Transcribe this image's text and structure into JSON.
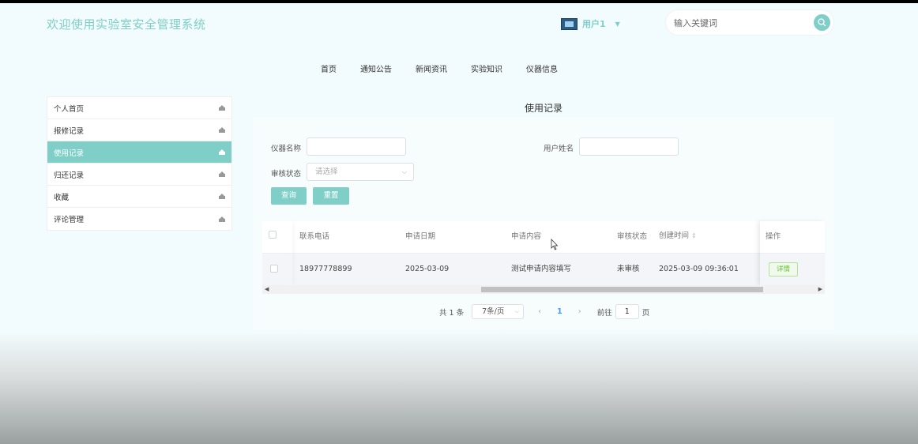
{
  "header": {
    "site_title": "欢迎使用实验室安全管理系统",
    "user_name": "用户1",
    "search_placeholder": "输入关键词"
  },
  "nav": [
    "首页",
    "通知公告",
    "新闻资讯",
    "实验知识",
    "仪器信息"
  ],
  "sidebar": {
    "items": [
      {
        "label": "个人首页",
        "active": false
      },
      {
        "label": "报修记录",
        "active": false
      },
      {
        "label": "使用记录",
        "active": true
      },
      {
        "label": "归还记录",
        "active": false
      },
      {
        "label": "收藏",
        "active": false
      },
      {
        "label": "评论管理",
        "active": false
      }
    ]
  },
  "main": {
    "heading": "使用记录",
    "filters": {
      "instrument_label": "仪器名称",
      "instrument_value": "",
      "username_label": "用户姓名",
      "username_value": "",
      "status_label": "审核状态",
      "status_placeholder": "请选择"
    },
    "buttons": {
      "query": "查询",
      "reset": "重置"
    },
    "table": {
      "columns": [
        "联系电话",
        "申请日期",
        "申请内容",
        "审核状态",
        "创建时间",
        "操作"
      ],
      "rows": [
        {
          "phone": "18977778899",
          "date": "2025-03-09",
          "content": "测试申请内容填写",
          "status": "未审核",
          "created": "2025-03-09 09:36:01",
          "action": "详情"
        }
      ]
    },
    "pagination": {
      "total": "共 1 条",
      "page_size": "7条/页",
      "current": "1",
      "goto_prefix": "前往",
      "goto_value": "1",
      "goto_suffix": "页"
    }
  },
  "colors": {
    "accent": "#7fcfc8",
    "page_bg": "#f2fbfd"
  }
}
